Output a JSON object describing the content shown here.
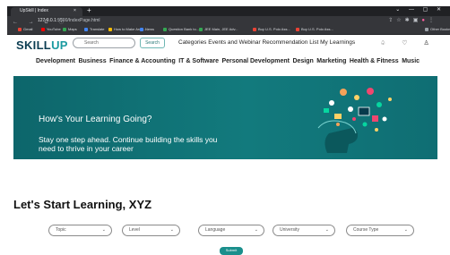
{
  "browser": {
    "tab_title": "UpSkill | Index",
    "tab_close": "×",
    "new_tab": "+",
    "window_controls": "⌄ — ▢ ✕",
    "nav_buttons": "← → C ⓘ",
    "url_host": "127.0.0.1",
    "url_path": ":5500/IndexPage.html",
    "bookmarks": [
      {
        "label": "Gmail",
        "color": "#ea4335"
      },
      {
        "label": "YouTube",
        "color": "#ff0000"
      },
      {
        "label": "Maps",
        "color": "#34a853"
      },
      {
        "label": "Translate",
        "color": "#4285f4"
      },
      {
        "label": "How to Make Arch...",
        "color": "#fbbc05"
      },
      {
        "label": "News",
        "color": "#4285f4"
      },
      {
        "label": "Question Bank to...",
        "color": "#34a853"
      },
      {
        "label": "JEE Main, JEE Adv...",
        "color": "#34a853"
      },
      {
        "label": "Buy U.S. Polo Ass...",
        "color": "#ea4335"
      },
      {
        "label": "Buy U.S. Polo Ass...",
        "color": "#ea4335"
      },
      {
        "label": "Other Bookmarks",
        "color": "#9aa0a6"
      }
    ]
  },
  "header": {
    "logo_main": "SKILL",
    "logo_accent": "UP",
    "search_placeholder": "Search",
    "search_button": "Search",
    "nav": "Categories Events and Webinar Recommendation List My Learnings",
    "icons": [
      "bell-icon",
      "heart-icon",
      "user-icon"
    ],
    "icon_glyphs": "♤ ♡ ♙"
  },
  "categories": [
    "Development",
    "Business",
    "Finance & Accounting",
    "IT & Software",
    "Personal Development",
    "Design",
    "Marketing",
    "Health & Fitness",
    "Music"
  ],
  "hero": {
    "title": "How's Your Learning Going?",
    "subtitle": "Stay one step ahead. Continue building the skills you need to thrive in your career",
    "background": "#0f6e73"
  },
  "learning": {
    "heading": "Let's Start Learning, XYZ",
    "filters": [
      "Topic",
      "Level",
      "Language",
      "University",
      "Course Type"
    ],
    "chevron": "⌄",
    "submit": "Submit"
  },
  "colors": {
    "brand": "#0b3d52",
    "accent": "#1a9aa0"
  }
}
